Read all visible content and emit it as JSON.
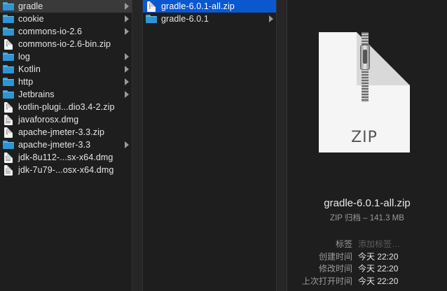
{
  "column1": {
    "items": [
      {
        "label": "gradle",
        "type": "folder",
        "state": "highlight",
        "has_children": true
      },
      {
        "label": "cookie",
        "type": "folder",
        "has_children": true
      },
      {
        "label": "commons-io-2.6",
        "type": "folder",
        "has_children": true
      },
      {
        "label": "commons-io-2.6-bin.zip",
        "type": "zip"
      },
      {
        "label": "log",
        "type": "folder",
        "has_children": true
      },
      {
        "label": "Kotlin",
        "type": "folder",
        "has_children": true
      },
      {
        "label": "http",
        "type": "folder",
        "has_children": true
      },
      {
        "label": "Jetbrains",
        "type": "folder",
        "has_children": true
      },
      {
        "label": "kotlin-plugi...dio3.4-2.zip",
        "type": "zip"
      },
      {
        "label": "javaforosx.dmg",
        "type": "dmg"
      },
      {
        "label": "apache-jmeter-3.3.zip",
        "type": "zip"
      },
      {
        "label": "apache-jmeter-3.3",
        "type": "folder",
        "has_children": true
      },
      {
        "label": "jdk-8u112-...sx-x64.dmg",
        "type": "dmg"
      },
      {
        "label": "jdk-7u79-...osx-x64.dmg",
        "type": "dmg"
      }
    ]
  },
  "column2": {
    "items": [
      {
        "label": "gradle-6.0.1-all.zip",
        "type": "zip",
        "state": "selected"
      },
      {
        "label": "gradle-6.0.1",
        "type": "folder",
        "has_children": true
      }
    ]
  },
  "preview": {
    "icon_text": "ZIP",
    "file_name": "gradle-6.0.1-all.zip",
    "kind_size": "ZIP 归档 – 141.3 MB",
    "meta": [
      {
        "key": "标签",
        "value": "添加标签…",
        "placeholder": true
      },
      {
        "key": "创建时间",
        "value": "今天 22:20"
      },
      {
        "key": "修改时间",
        "value": "今天 22:20"
      },
      {
        "key": "上次打开时间",
        "value": "今天 22:20"
      }
    ]
  },
  "colors": {
    "selection": "#0a58d0",
    "folder": "#2f95d2",
    "background": "#1e1e1e"
  }
}
